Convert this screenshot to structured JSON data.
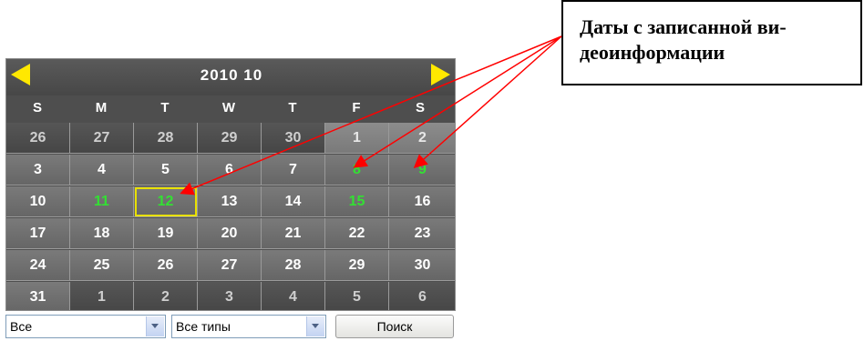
{
  "calendar": {
    "title": "2010  10",
    "weekdays": [
      "S",
      "M",
      "T",
      "W",
      "T",
      "F",
      "S"
    ],
    "days": [
      {
        "label": "26",
        "state": "adj"
      },
      {
        "label": "27",
        "state": "adj"
      },
      {
        "label": "28",
        "state": "adj"
      },
      {
        "label": "29",
        "state": "adj"
      },
      {
        "label": "30",
        "state": "adj"
      },
      {
        "label": "1",
        "state": "adj-light"
      },
      {
        "label": "2",
        "state": "adj-light"
      },
      {
        "label": "3",
        "state": "cur"
      },
      {
        "label": "4",
        "state": "cur"
      },
      {
        "label": "5",
        "state": "cur"
      },
      {
        "label": "6",
        "state": "cur"
      },
      {
        "label": "7",
        "state": "cur"
      },
      {
        "label": "8",
        "state": "cur",
        "recorded": true
      },
      {
        "label": "9",
        "state": "cur",
        "recorded": true
      },
      {
        "label": "10",
        "state": "cur"
      },
      {
        "label": "11",
        "state": "cur",
        "recorded": true
      },
      {
        "label": "12",
        "state": "cur",
        "recorded": true,
        "selected": true
      },
      {
        "label": "13",
        "state": "cur"
      },
      {
        "label": "14",
        "state": "cur"
      },
      {
        "label": "15",
        "state": "cur",
        "recorded": true
      },
      {
        "label": "16",
        "state": "cur"
      },
      {
        "label": "17",
        "state": "cur"
      },
      {
        "label": "18",
        "state": "cur"
      },
      {
        "label": "19",
        "state": "cur"
      },
      {
        "label": "20",
        "state": "cur"
      },
      {
        "label": "21",
        "state": "cur"
      },
      {
        "label": "22",
        "state": "cur"
      },
      {
        "label": "23",
        "state": "cur"
      },
      {
        "label": "24",
        "state": "cur"
      },
      {
        "label": "25",
        "state": "cur"
      },
      {
        "label": "26",
        "state": "cur"
      },
      {
        "label": "27",
        "state": "cur"
      },
      {
        "label": "28",
        "state": "cur"
      },
      {
        "label": "29",
        "state": "cur"
      },
      {
        "label": "30",
        "state": "cur"
      },
      {
        "label": "31",
        "state": "cur"
      },
      {
        "label": "1",
        "state": "adj"
      },
      {
        "label": "2",
        "state": "adj"
      },
      {
        "label": "3",
        "state": "adj"
      },
      {
        "label": "4",
        "state": "adj"
      },
      {
        "label": "5",
        "state": "adj"
      },
      {
        "label": "6",
        "state": "adj"
      }
    ]
  },
  "controls": {
    "channel_select": "Все",
    "type_select": "Все типы",
    "search_button": "Поиск"
  },
  "annotation": {
    "line1": "Даты с записанной ви-",
    "line2": "деоинформации"
  },
  "colors": {
    "recorded_day": "#33e033",
    "selected_outline": "#e8e000",
    "nav_arrow": "#ffe800",
    "annotation_arrow": "#ff0000"
  }
}
